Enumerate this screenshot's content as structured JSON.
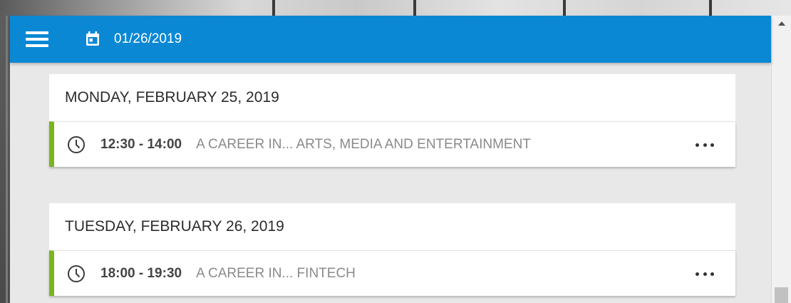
{
  "header": {
    "date": "01/26/2019",
    "menu_icon": "hamburger-icon",
    "calendar_icon": "calendar-icon",
    "background_color": "#0a88d4"
  },
  "days": [
    {
      "title": "MONDAY, FEBRUARY 25, 2019",
      "events": [
        {
          "time": "12:30 - 14:00",
          "title": "A CAREER IN... ARTS, MEDIA AND ENTERTAINMENT",
          "more": "more-icon"
        }
      ]
    },
    {
      "title": "TUESDAY, FEBRUARY 26, 2019",
      "events": [
        {
          "time": "18:00 - 19:30",
          "title": "A CAREER IN... FINTECH",
          "more": "more-icon"
        }
      ]
    }
  ],
  "colors": {
    "accent": "#0a88d4",
    "event_marker": "#7ab51d",
    "page_background": "#e8e8e8"
  }
}
